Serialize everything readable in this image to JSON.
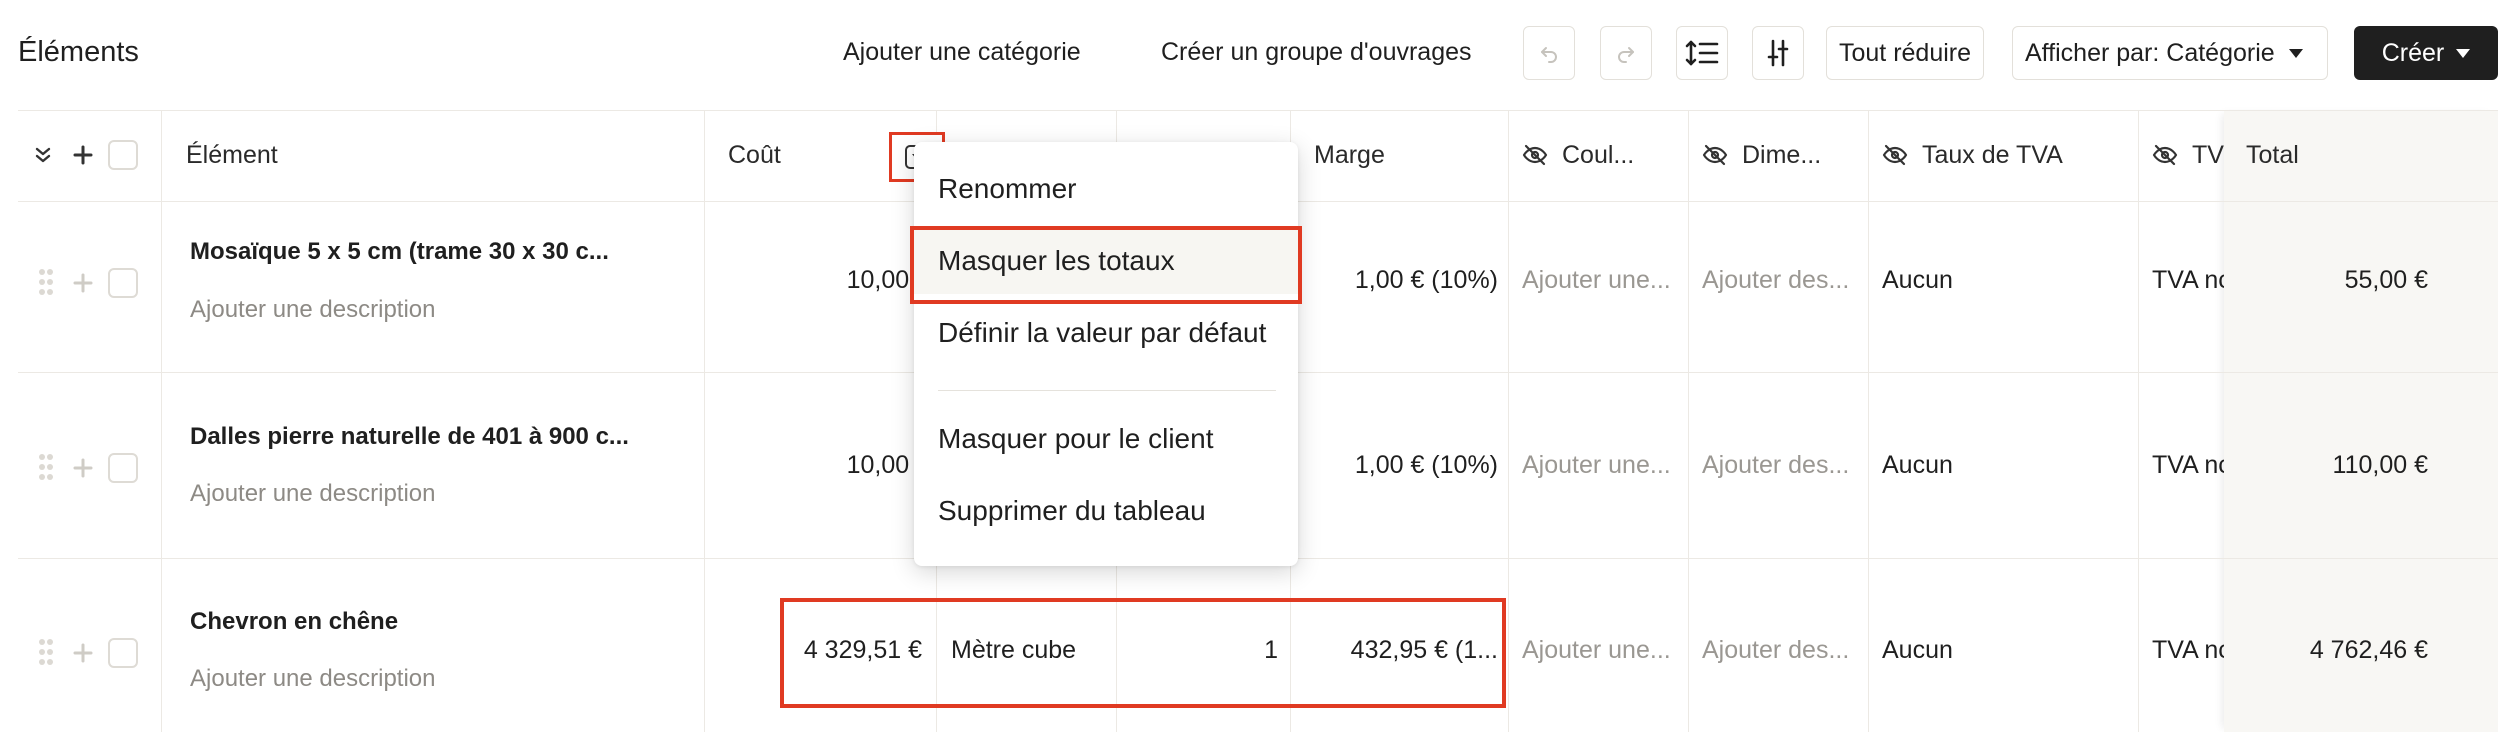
{
  "toolbar": {
    "title": "Éléments",
    "add_category": "Ajouter une catégorie",
    "create_group": "Créer un groupe d'ouvrages",
    "collapse_all": "Tout réduire",
    "display_by": "Afficher par: Catégorie",
    "create": "Créer",
    "icons": [
      "undo-icon",
      "redo-icon",
      "line-height-icon",
      "sliders-icon"
    ]
  },
  "columns": {
    "element": "Élément",
    "cost": "Coût",
    "margin": "Marge",
    "color": "Coul...",
    "dimensions": "Dime...",
    "vat_rate": "Taux de TVA",
    "vat": "TV",
    "total": "Total"
  },
  "rows": [
    {
      "name": "Mosaïque 5 x 5 cm (trame 30 x 30 c...",
      "description": "Ajouter une description",
      "cost": "10,00 €",
      "unit": "",
      "quantity": "",
      "margin": "1,00 € (10%)",
      "color": "Ajouter une...",
      "dimensions": "Ajouter des...",
      "vat_rate": "Aucun",
      "vat": "TVA nc",
      "total": "55,00 €"
    },
    {
      "name": "Dalles pierre naturelle de 401 à 900 c...",
      "description": "Ajouter une description",
      "cost": "10,00 €",
      "unit": "",
      "quantity": "",
      "margin": "1,00 € (10%)",
      "color": "Ajouter une...",
      "dimensions": "Ajouter des...",
      "vat_rate": "Aucun",
      "vat": "TVA nc",
      "total": "110,00 €"
    },
    {
      "name": "Chevron en chêne",
      "description": "Ajouter une description",
      "cost": "4 329,51 €",
      "unit": "Mètre cube",
      "quantity": "1",
      "margin": "432,95 € (1...",
      "color": "Ajouter une...",
      "dimensions": "Ajouter des...",
      "vat_rate": "Aucun",
      "vat": "TVA nc",
      "total": "4 762,46 €"
    }
  ],
  "menu": {
    "rename": "Renommer",
    "hide_totals": "Masquer les totaux",
    "set_default": "Définir la valeur par défaut",
    "hide_client": "Masquer pour le client",
    "remove": "Supprimer du tableau"
  },
  "colors": {
    "highlight": "#e03a22",
    "primary_button": "#1f1f1f",
    "total_column_bg": "#f8f7f4"
  }
}
